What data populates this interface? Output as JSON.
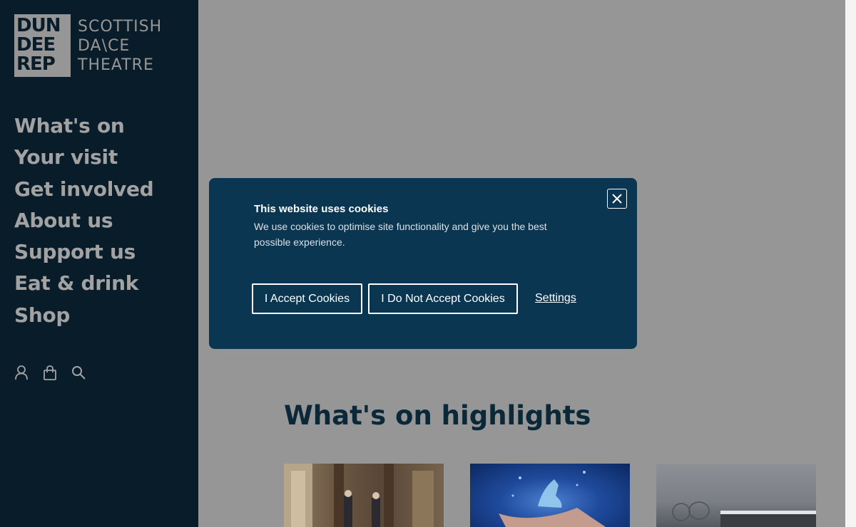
{
  "logo": {
    "block_lines": [
      "DUN",
      "DEE",
      "REP"
    ],
    "text_lines": [
      "SCOTTISH",
      "DA\\CE",
      "THEATRE"
    ]
  },
  "nav": {
    "items": [
      "What's on",
      "Your visit",
      "Get involved",
      "About us",
      "Support us",
      "Eat & drink",
      "Shop"
    ]
  },
  "header_icons": [
    "account-icon",
    "basket-icon",
    "search-icon"
  ],
  "cookie_modal": {
    "title": "This website uses cookies",
    "body": "We use cookies to optimise site functionality and give you the best possible experience.",
    "accept_label": "I Accept Cookies",
    "decline_label": "I Do Not Accept Cookies",
    "settings_label": "Settings"
  },
  "main": {
    "section_title": "What's on highlights"
  },
  "colors": {
    "sidebar_bg": "#081c2a",
    "modal_bg": "#0b3651",
    "overlay_bg": "#979696",
    "title_color": "#0a2838"
  }
}
